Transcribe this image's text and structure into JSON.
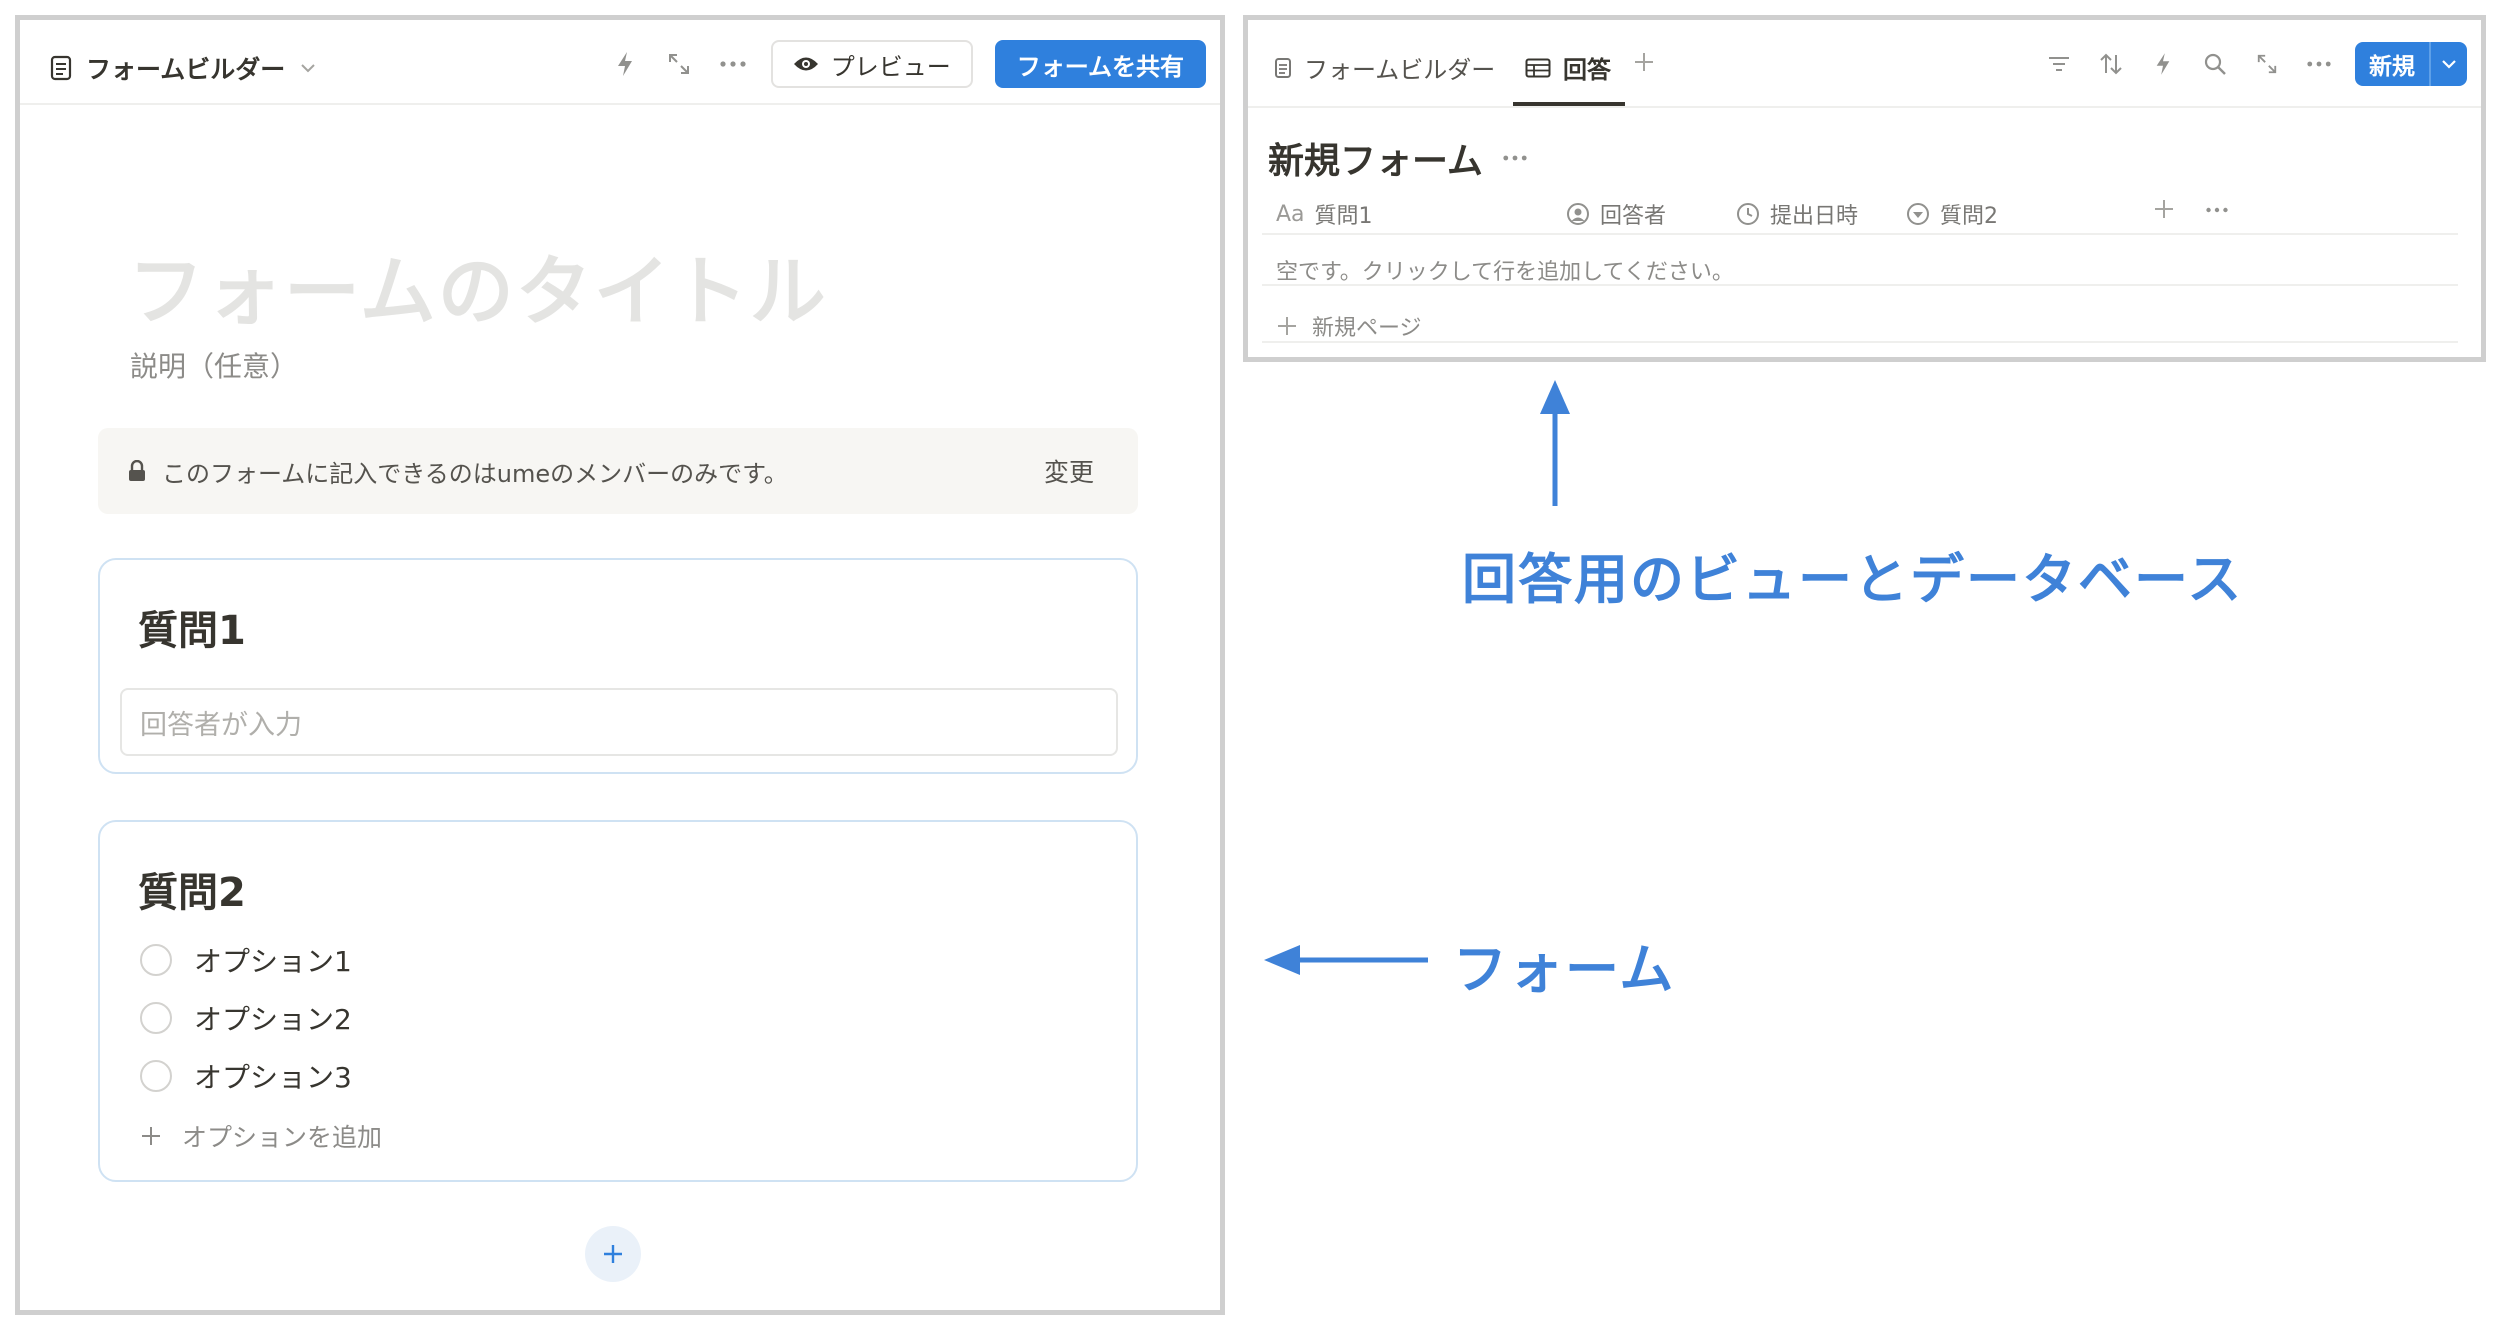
{
  "form_panel": {
    "header": {
      "title": "フォームビルダー",
      "preview_label": "プレビュー",
      "share_label": "フォームを共有"
    },
    "form": {
      "title_placeholder": "フォームのタイトル",
      "description_placeholder": "説明（任意）",
      "notice": {
        "text": "このフォームに記入できるのはumeのメンバーのみです。",
        "change_label": "変更"
      },
      "questions": [
        {
          "title": "質問1",
          "input_placeholder": "回答者が入力"
        },
        {
          "title": "質問2",
          "options": [
            "オプション1",
            "オプション2",
            "オプション3"
          ],
          "add_option_label": "オプションを追加"
        }
      ]
    }
  },
  "db_panel": {
    "tabs": [
      {
        "label": "フォームビルダー"
      },
      {
        "label": "回答"
      }
    ],
    "new_button_label": "新規",
    "title": "新規フォーム",
    "columns": [
      {
        "icon_text": "Aa",
        "label": "質問1"
      },
      {
        "label": "回答者"
      },
      {
        "label": "提出日時"
      },
      {
        "label": "質問2"
      }
    ],
    "empty_text": "空です。クリックして行を追加してください。",
    "new_page_label": "新規ページ"
  },
  "annotations": {
    "db_label": "回答用のビューとデータベース",
    "form_label": "フォーム"
  },
  "colors": {
    "accent": "#2f80dd",
    "annotation": "#3f82d8",
    "card_border": "#cfe2f3",
    "panel_border": "#cfcfcf"
  }
}
